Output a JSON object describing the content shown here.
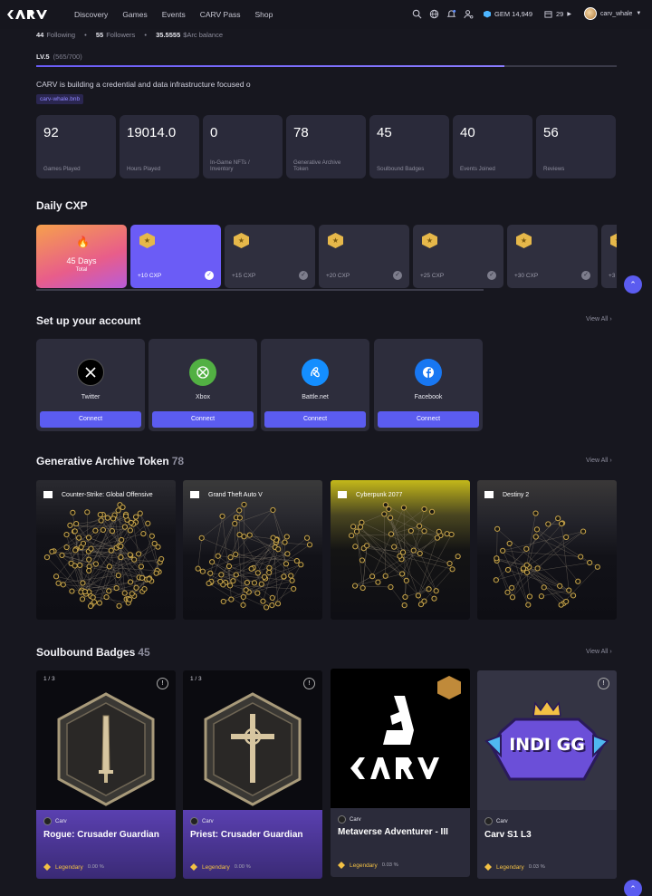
{
  "nav": {
    "links": [
      "Discovery",
      "Games",
      "Events",
      "CARV Pass",
      "Shop"
    ],
    "gem_label": "GEM 14,949",
    "calendar_count": "29",
    "username": "carv_whale"
  },
  "profile": {
    "following_count": "44",
    "following_label": "Following",
    "followers_count": "55",
    "followers_label": "Followers",
    "balance": "35.5555",
    "balance_label": "$Arc balance",
    "level": "LV.5",
    "level_progress": "(565/700)",
    "level_fraction": 0.807,
    "bio": "CARV is building a credential and data infrastructure focused o",
    "tag": "carv-whale.bnb"
  },
  "stats": [
    {
      "value": "92",
      "label": "Games Played"
    },
    {
      "value": "19014.0",
      "label": "Hours Played"
    },
    {
      "value": "0",
      "label": "In-Game NFTs / Inventory"
    },
    {
      "value": "78",
      "label": "Generative Archive Token"
    },
    {
      "value": "45",
      "label": "Soulbound Badges"
    },
    {
      "value": "40",
      "label": "Events Joined"
    },
    {
      "value": "56",
      "label": "Reviews"
    }
  ],
  "daily_cxp": {
    "title": "Daily CXP",
    "streak_days": "45 Days",
    "streak_label": "Total",
    "cards": [
      "+10 CXP",
      "+15 CXP",
      "+20 CXP",
      "+25 CXP",
      "+30 CXP",
      "+3"
    ]
  },
  "setup": {
    "title": "Set up your account",
    "view_all": "View All",
    "accounts": [
      {
        "name": "Twitter",
        "button": "Connect",
        "color": "#000000"
      },
      {
        "name": "Xbox",
        "button": "Connect",
        "color": "#52b043"
      },
      {
        "name": "Battle.net",
        "button": "Connect",
        "color": "#148eff"
      },
      {
        "name": "Facebook",
        "button": "Connect",
        "color": "#1877f2"
      }
    ]
  },
  "gat": {
    "title": "Generative Archive Token",
    "count": "78",
    "view_all": "View All",
    "items": [
      {
        "name": "Counter-Strike: Global Offensive"
      },
      {
        "name": "Grand Theft Auto V"
      },
      {
        "name": "Cyberpunk 2077"
      },
      {
        "name": "Destiny 2"
      }
    ]
  },
  "badges": {
    "title": "Soulbound Badges",
    "count": "45",
    "view_all": "View All",
    "items": [
      {
        "count": "1 / 3",
        "issuer": "Carv",
        "name": "Rogue: Crusader Guardian",
        "rarity": "Legendary",
        "percent": "0.00 %"
      },
      {
        "count": "1 / 3",
        "issuer": "Carv",
        "name": "Priest: Crusader Guardian",
        "rarity": "Legendary",
        "percent": "0.00 %"
      },
      {
        "issuer": "Carv",
        "name": "Metaverse Adventurer - III",
        "rarity": "Legendary",
        "percent": "0.03 %"
      },
      {
        "issuer": "Carv",
        "name": "Carv S1 L3",
        "rarity": "Legendary",
        "percent": "0.03 %"
      }
    ]
  },
  "logo_text": "CARV",
  "indi_text": "INDI GG",
  "colors": {
    "accent": "#5b5cf0",
    "legendary": "#f3c144",
    "background": "#17171f"
  }
}
